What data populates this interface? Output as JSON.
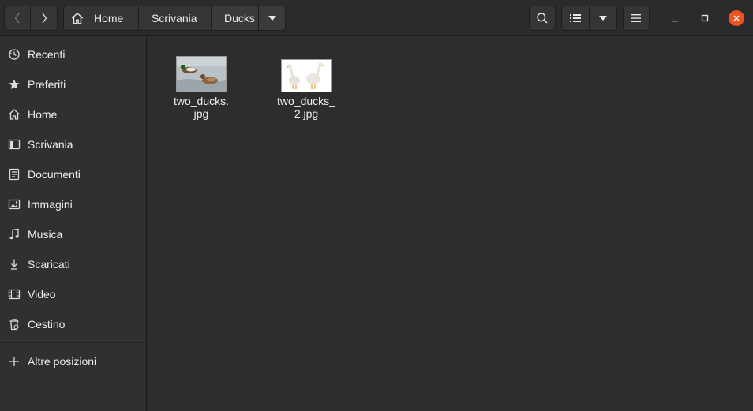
{
  "toolbar": {
    "back_icon": "chevron-left-icon",
    "forward_icon": "chevron-right-icon",
    "search_icon": "search-icon",
    "view_icon": "list-view-icon",
    "menu_icon": "hamburger-menu-icon"
  },
  "breadcrumb": {
    "items": [
      {
        "label": "Home",
        "icon": "home-icon"
      },
      {
        "label": "Scrivania"
      },
      {
        "label": "Ducks"
      }
    ]
  },
  "sidebar": {
    "items": [
      {
        "label": "Recenti",
        "icon": "clock-icon"
      },
      {
        "label": "Preferiti",
        "icon": "star-icon"
      },
      {
        "label": "Home",
        "icon": "home-icon"
      },
      {
        "label": "Scrivania",
        "icon": "desktop-icon"
      },
      {
        "label": "Documenti",
        "icon": "document-icon"
      },
      {
        "label": "Immagini",
        "icon": "image-icon"
      },
      {
        "label": "Musica",
        "icon": "music-icon"
      },
      {
        "label": "Scaricati",
        "icon": "download-icon"
      },
      {
        "label": "Video",
        "icon": "video-icon"
      },
      {
        "label": "Cestino",
        "icon": "trash-icon"
      },
      {
        "label": "Altre posizioni",
        "icon": "plus-icon"
      }
    ]
  },
  "files": [
    {
      "name": "two_ducks.\njpg"
    },
    {
      "name": "two_ducks_\n2.jpg"
    }
  ],
  "colors": {
    "accent": "#e95420",
    "background": "#2d2d2d",
    "sidebar": "#303030"
  }
}
